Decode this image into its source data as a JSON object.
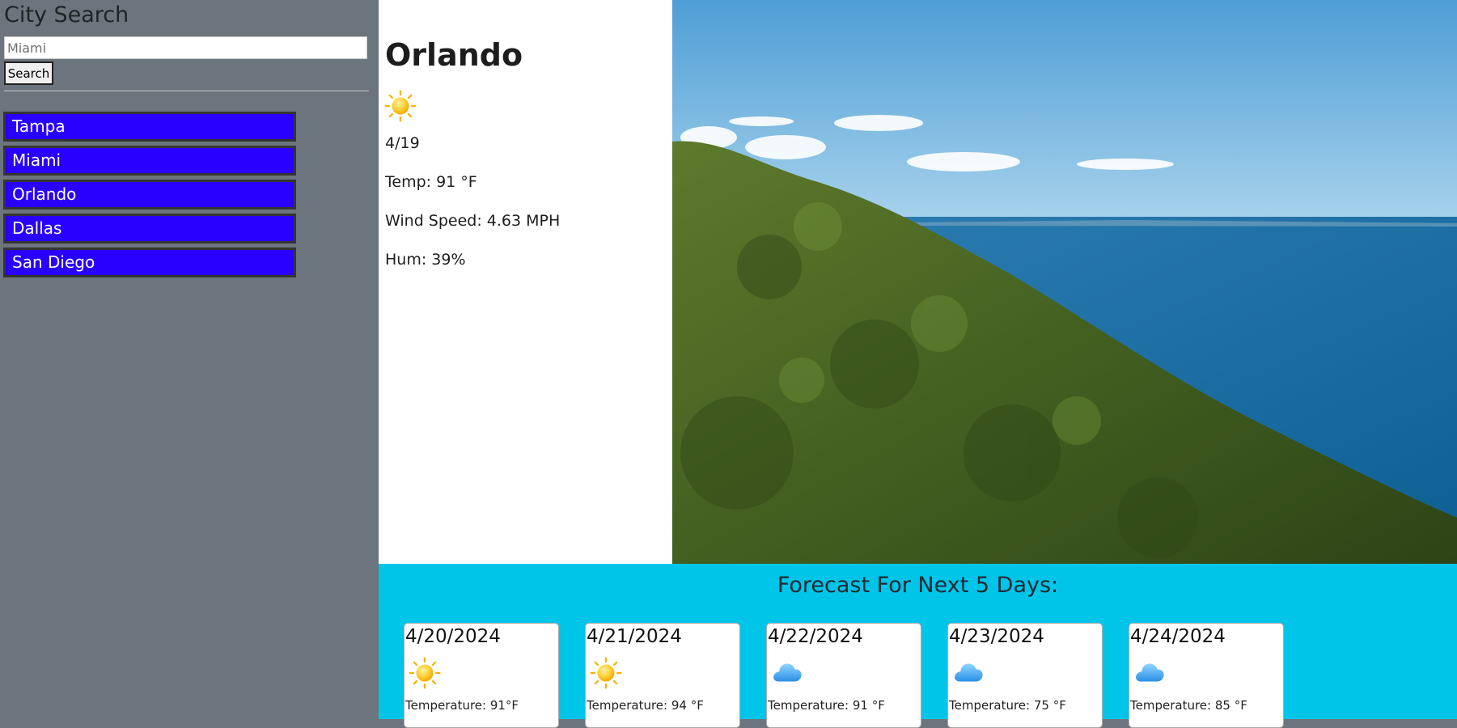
{
  "sidebar": {
    "title": "City Search",
    "search_placeholder": "Miami",
    "search_button": "Search",
    "history": [
      "Tampa",
      "Miami",
      "Orlando",
      "Dallas",
      "San Diego"
    ]
  },
  "current": {
    "city": "Orlando",
    "icon": "sun-icon",
    "date": "4/19",
    "temp": "Temp: 91 °F",
    "wind": "Wind Speed: 4.63 MPH",
    "humidity": "Hum: 39%"
  },
  "forecast": {
    "heading": "Forecast For Next 5 Days:",
    "days": [
      {
        "date": "4/20/2024",
        "icon": "sun-icon",
        "temp": "Temperature: 91°F"
      },
      {
        "date": "4/21/2024",
        "icon": "sun-icon",
        "temp": "Temperature: 94 °F"
      },
      {
        "date": "4/22/2024",
        "icon": "cloud-icon",
        "temp": "Temperature: 91 °F"
      },
      {
        "date": "4/23/2024",
        "icon": "cloud-icon",
        "temp": "Temperature: 75 °F"
      },
      {
        "date": "4/24/2024",
        "icon": "cloud-icon",
        "temp": "Temperature: 85 °F"
      }
    ]
  },
  "colors": {
    "sidebar_bg": "#6c757d",
    "city_button": "#2900ff",
    "forecast_bg": "#00c5e9"
  }
}
